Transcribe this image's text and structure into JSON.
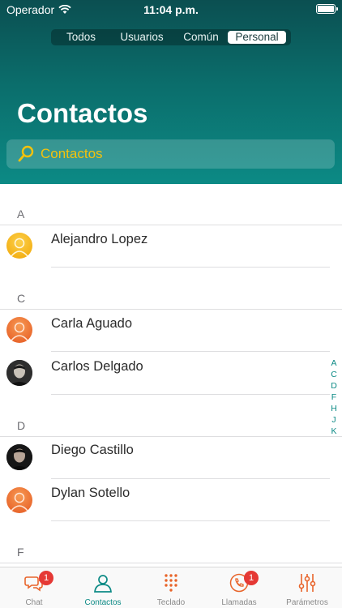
{
  "status_bar": {
    "carrier": "Operador",
    "time": "11:04 p.m."
  },
  "segments": [
    {
      "label": "Todos",
      "active": false
    },
    {
      "label": "Usuarios",
      "active": false
    },
    {
      "label": "Común",
      "active": false
    },
    {
      "label": "Personal",
      "active": true
    }
  ],
  "title": "Contactos",
  "search": {
    "placeholder": "Contactos"
  },
  "sections": [
    {
      "letter": "A",
      "contacts": [
        {
          "name": "Alejandro Lopez",
          "avatar": "default-yellow"
        }
      ]
    },
    {
      "letter": "C",
      "contacts": [
        {
          "name": "Carla Aguado",
          "avatar": "default-orange"
        },
        {
          "name": "Carlos Delgado",
          "avatar": "photo"
        }
      ]
    },
    {
      "letter": "D",
      "contacts": [
        {
          "name": "Diego Castillo",
          "avatar": "photo"
        },
        {
          "name": "Dylan Sotello",
          "avatar": "default-orange"
        }
      ]
    },
    {
      "letter": "F",
      "contacts": []
    }
  ],
  "index": [
    "A",
    "C",
    "D",
    "F",
    "H",
    "J",
    "K"
  ],
  "tabs": [
    {
      "label": "Chat",
      "icon": "chat-bubbles-icon",
      "badge": "1",
      "active": false
    },
    {
      "label": "Contactos",
      "icon": "person-icon",
      "active": true
    },
    {
      "label": "Teclado",
      "icon": "keypad-icon",
      "active": false
    },
    {
      "label": "Llamadas",
      "icon": "phone-call-icon",
      "badge": "1",
      "active": false
    },
    {
      "label": "Parámetros",
      "icon": "sliders-icon",
      "active": false
    }
  ],
  "colors": {
    "accent": "#0c8a85",
    "brand_orange": "#e8642a",
    "search_text": "#f4c20d",
    "badge": "#e53935"
  }
}
